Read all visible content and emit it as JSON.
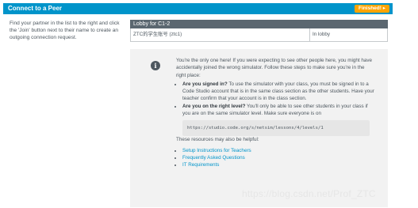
{
  "header": {
    "title": "Connect to a Peer",
    "finished_label": "Finished!",
    "finished_icon": "chevron-right-icon"
  },
  "instructions": "Find your partner in the list to the right and click the 'Join' button next to their name to create an outgoing connection request.",
  "lobby": {
    "title": "Lobby for C1-2",
    "rows": [
      {
        "name": "ZTC的学生账号 (ztc1)",
        "status": "In lobby"
      }
    ]
  },
  "notice": {
    "icon": "info-icon",
    "intro": "You're the only one here! If you were expecting to see other people here, you might have accidentally joined the wrong simulator. Follow these steps to make sure you're in the right place:",
    "steps": [
      {
        "bold": "Are you signed in?",
        "text": " To use the simulator with your class, you must be signed in to a Code Studio account that is in the same class section as the other students. Have your teacher confirm that your account is in the class section."
      },
      {
        "bold": "Are you on the right level?",
        "text": " You'll only be able to see other students in your class if you are on the same simulator level. Make sure everyone is on"
      }
    ],
    "url": "https://studio.code.org/s/netsim/lessons/4/levels/1",
    "resources_intro": "These resources may also be helpful:",
    "links": [
      "Setup Instructions for Teachers",
      "Frequently Asked Questions",
      "IT Requirements"
    ]
  },
  "watermark": "https://blog.csdn.net/Prof_ZTC",
  "colors": {
    "header": "#0094ca",
    "finished": "#ffa400",
    "lobby_header": "#5b6770",
    "link": "#0094ca"
  }
}
